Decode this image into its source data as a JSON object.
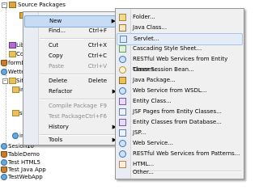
{
  "tree": {
    "root": "Source Packages",
    "selected_node": "",
    "projects": [
      "formDemo",
      "Wettech",
      "Site Ro",
      "Sesion10",
      "TableDemo",
      "Test HTML5",
      "Test Java App",
      "TestWebApp"
    ],
    "partial_items": [
      "Librari",
      "Configu",
      "im",
      "st",
      "ind"
    ]
  },
  "menu": {
    "items": [
      {
        "label": "New",
        "shortcut": "",
        "submenu": true
      },
      {
        "label": "Find...",
        "shortcut": "Ctrl+F"
      },
      {
        "label": "Cut",
        "shortcut": "Ctrl+X"
      },
      {
        "label": "Copy",
        "shortcut": "Ctrl+C"
      },
      {
        "label": "Paste",
        "shortcut": "Ctrl+V"
      },
      {
        "label": "Delete",
        "shortcut": "Delete"
      },
      {
        "label": "Refactor",
        "shortcut": "",
        "submenu": true
      },
      {
        "label": "Compile Package",
        "shortcut": "F9"
      },
      {
        "label": "Test Package",
        "shortcut": "Ctrl+F6"
      },
      {
        "label": "History",
        "shortcut": "",
        "submenu": true
      },
      {
        "label": "Tools",
        "shortcut": "",
        "submenu": true
      }
    ]
  },
  "submenu": {
    "items": [
      {
        "label": "Folder...",
        "icon": "folder-icon"
      },
      {
        "label": "Java Class...",
        "icon": "java-class-icon"
      },
      {
        "label": "Servlet...",
        "icon": "servlet-icon"
      },
      {
        "label": "Cascading Style Sheet...",
        "icon": "css-icon"
      },
      {
        "label": "RESTful Web Services from Entity Classes...",
        "icon": "web-service-icon"
      },
      {
        "label": "Timer Session Bean...",
        "icon": "timer-icon"
      },
      {
        "label": "Java Package...",
        "icon": "package-icon"
      },
      {
        "label": "Web Service from WSDL...",
        "icon": "web-service-icon"
      },
      {
        "label": "Entity Class...",
        "icon": "entity-icon"
      },
      {
        "label": "JSF Pages from Entity Classes...",
        "icon": "jsf-icon"
      },
      {
        "label": "Entity Classes from Database...",
        "icon": "entity-icon"
      },
      {
        "label": "JSP...",
        "icon": "jsp-icon"
      },
      {
        "label": "Web Service...",
        "icon": "web-service-icon"
      },
      {
        "label": "RESTful Web Services from Patterns...",
        "icon": "web-service-icon"
      },
      {
        "label": "HTML...",
        "icon": "html-icon"
      },
      {
        "label": "Other...",
        "icon": ""
      }
    ]
  },
  "colors": {
    "selection": "#3d80df",
    "menu_highlight": "#c6dcf5",
    "menu_bg": "#f0f0f0"
  }
}
